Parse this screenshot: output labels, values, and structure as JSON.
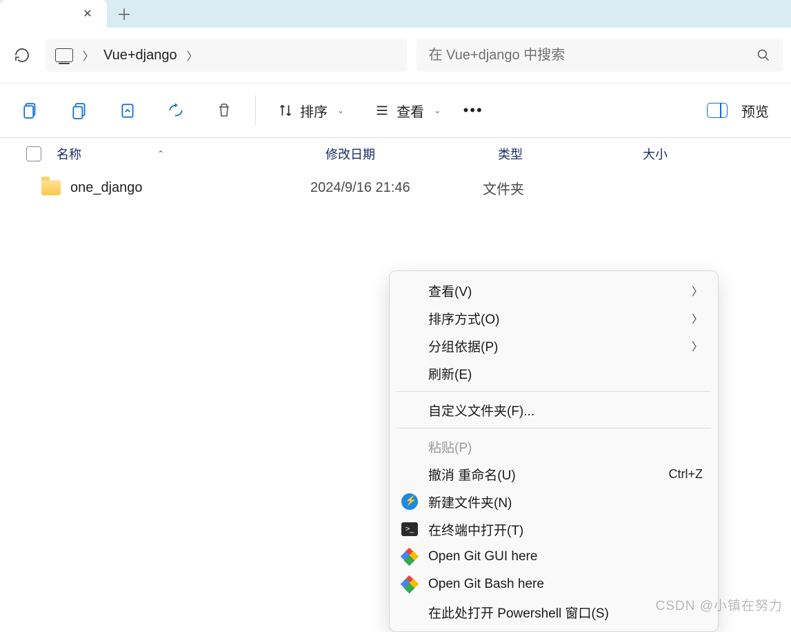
{
  "breadcrumb": {
    "folder": "Vue+django"
  },
  "search": {
    "placeholder": "在 Vue+django 中搜索"
  },
  "toolbar": {
    "sort": "排序",
    "view": "查看",
    "preview": "预览"
  },
  "columns": {
    "name": "名称",
    "date": "修改日期",
    "type": "类型",
    "size": "大小"
  },
  "files": [
    {
      "name": "one_django",
      "date": "2024/9/16 21:46",
      "type": "文件夹",
      "size": ""
    }
  ],
  "context_menu": {
    "view": "查看(V)",
    "sort_by": "排序方式(O)",
    "group_by": "分组依据(P)",
    "refresh": "刷新(E)",
    "customize": "自定义文件夹(F)...",
    "paste": "粘贴(P)",
    "undo_rename": "撤消 重命名(U)",
    "undo_shortcut": "Ctrl+Z",
    "new_folder": "新建文件夹(N)",
    "open_terminal": "在终端中打开(T)",
    "git_gui": "Open Git GUI here",
    "git_bash": "Open Git Bash here",
    "open_powershell": "在此处打开 Powershell 窗口(S)"
  },
  "watermark": "CSDN @小镇在努力"
}
